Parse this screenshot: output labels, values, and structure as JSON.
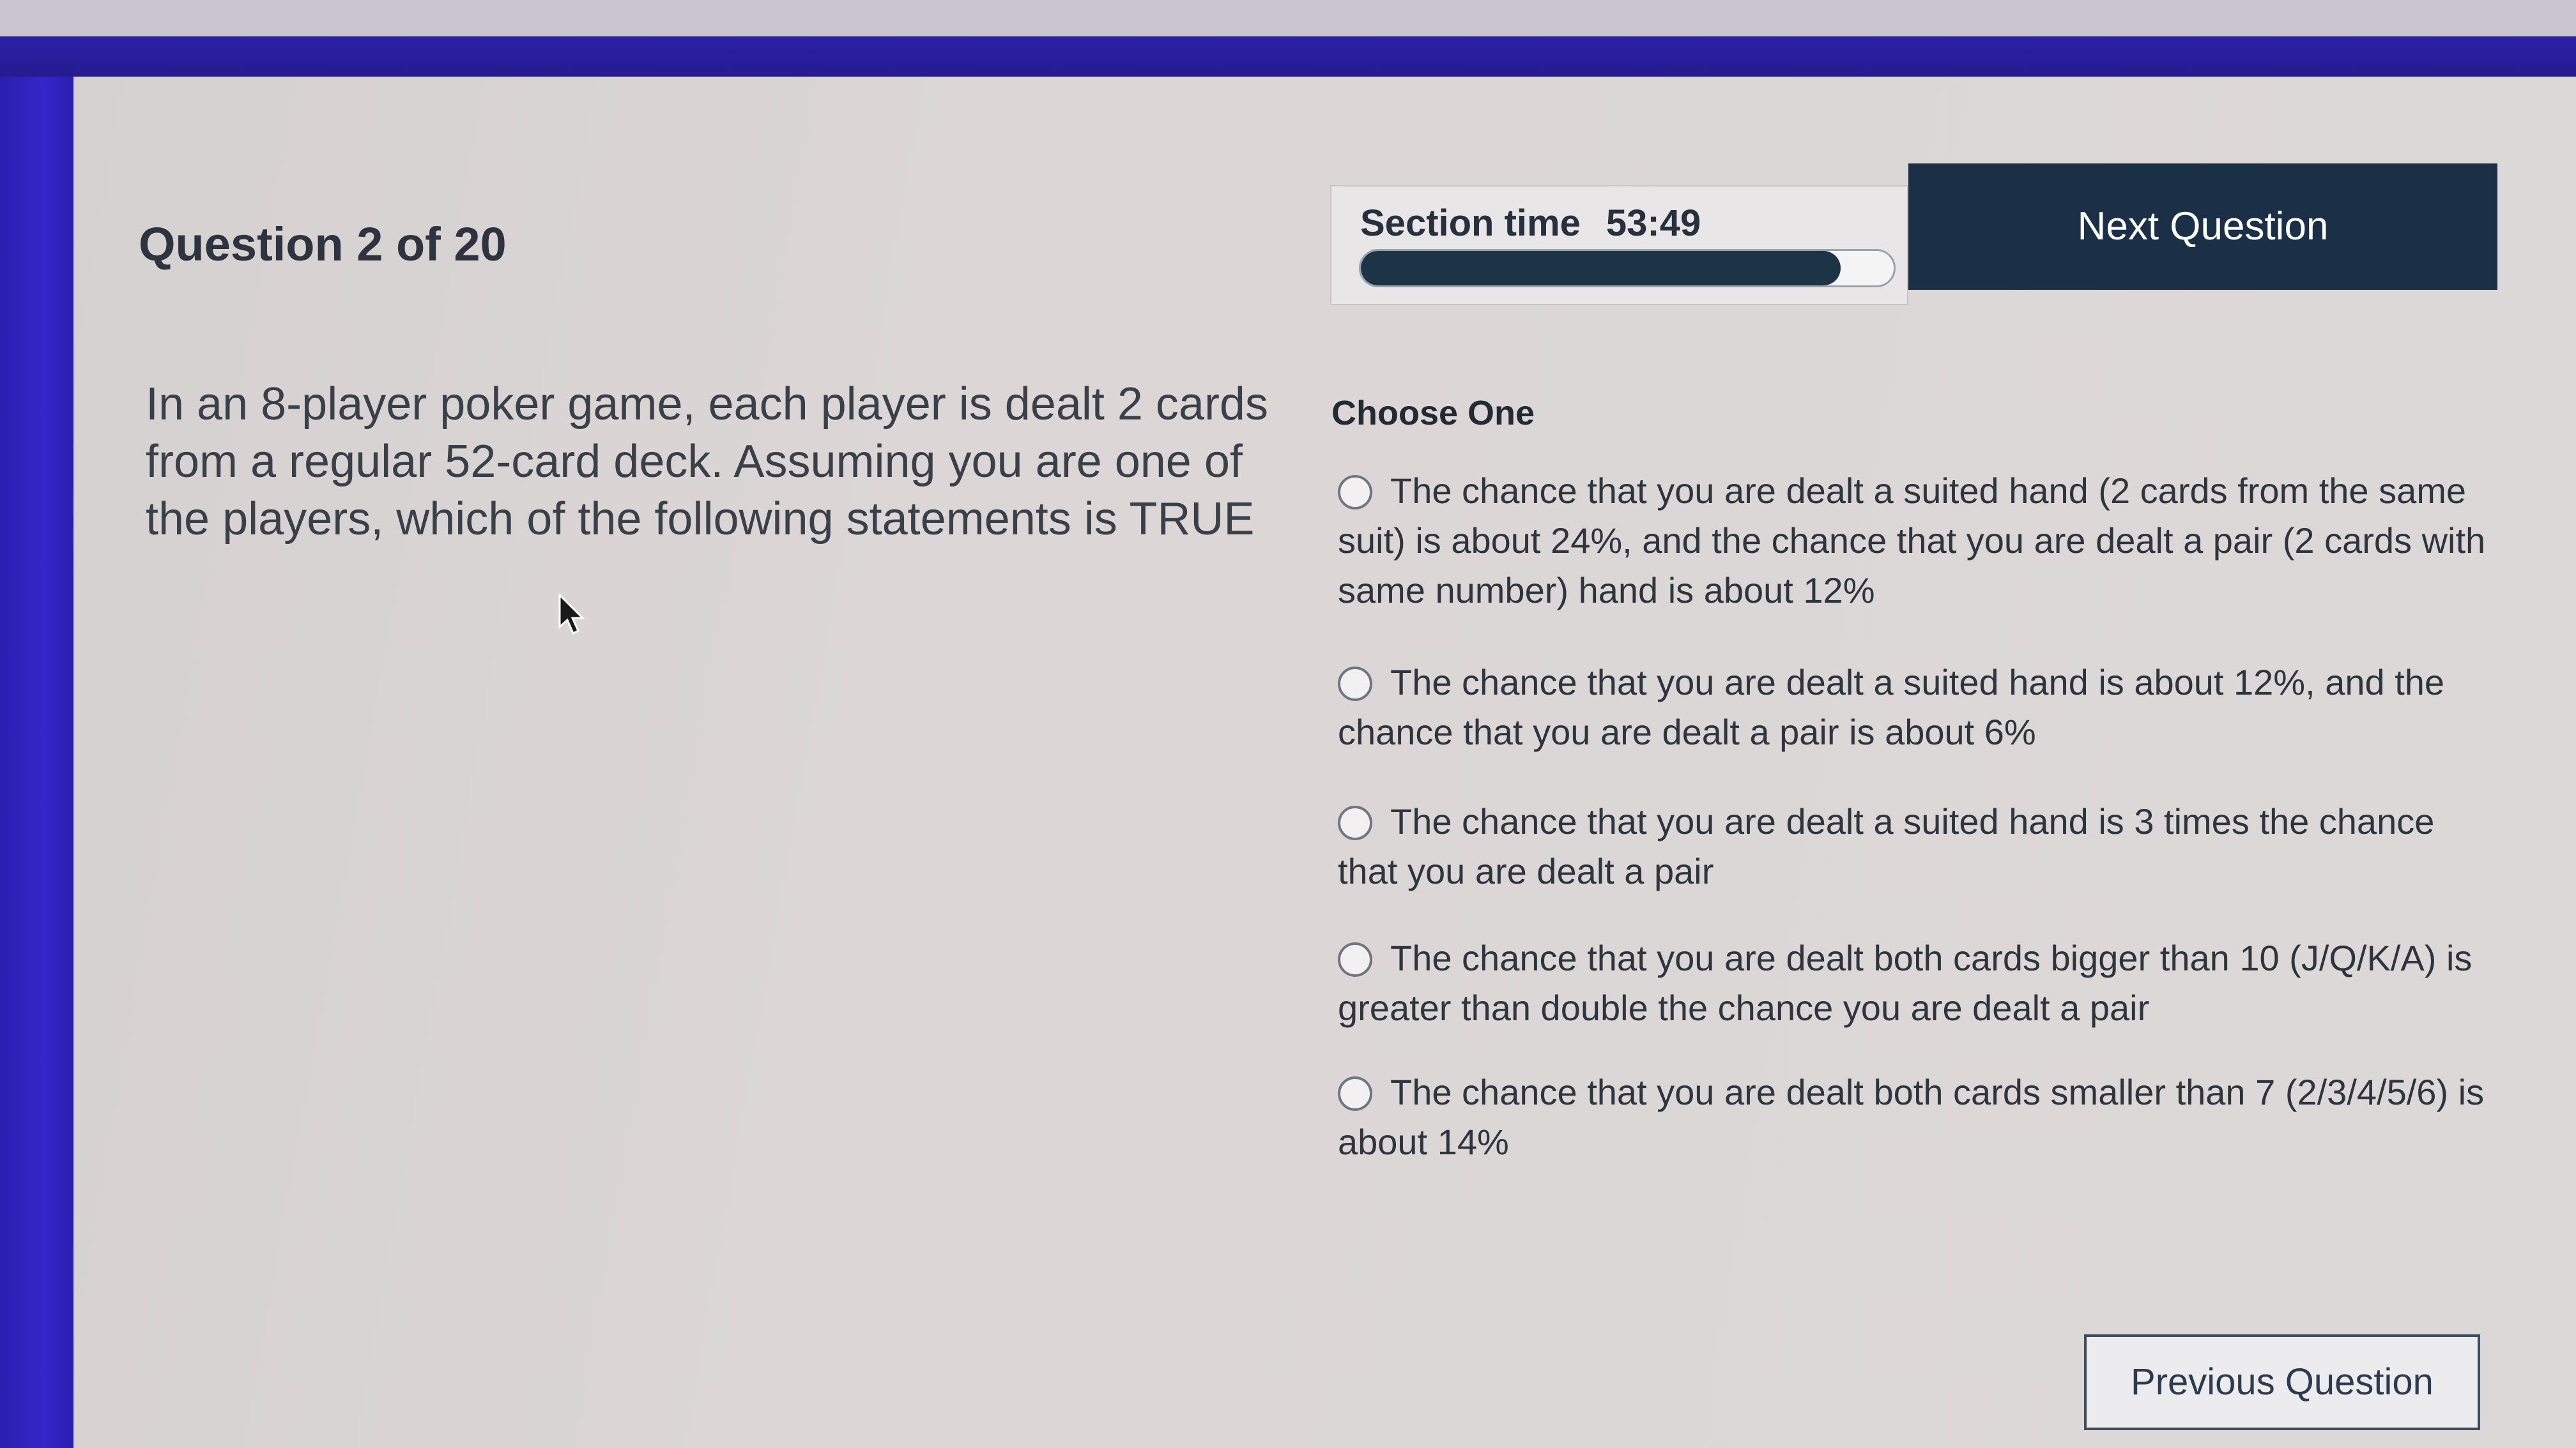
{
  "header": {
    "question_counter": "Question 2 of 20",
    "section_time_label": "Section time",
    "section_time_value": "53:49",
    "time_remaining_fraction": 0.9,
    "next_button_label": "Next Question"
  },
  "question": {
    "text": "In an 8-player poker game, each player is dealt 2 cards from a regular 52-card deck. Assuming you are one of the players, which of the following statements is TRUE"
  },
  "answers": {
    "instruction": "Choose One",
    "options": [
      {
        "label": "The chance that you are dealt a suited hand (2 cards from the same suit) is about 24%, and the chance that you are dealt a pair (2 cards with same number) hand is about 12%",
        "selected": false
      },
      {
        "label": "The chance that you are dealt a suited hand is about 12%, and the chance that you are dealt a pair is about 6%",
        "selected": false
      },
      {
        "label": "The chance that you are dealt a suited hand is 3 times the chance that you are dealt a pair",
        "selected": false
      },
      {
        "label": "The chance that you are dealt both cards bigger than 10 (J/Q/K/A) is greater than double the chance you are dealt a pair",
        "selected": false
      },
      {
        "label": "The chance that you are dealt both cards smaller than 7 (2/3/4/5/6) is about 14%",
        "selected": false
      }
    ]
  },
  "footer": {
    "previous_button_label": "Previous Question"
  },
  "icons": {
    "cursor": "mouse-pointer-icon",
    "radio": "radio-unselected-icon"
  },
  "colors": {
    "primary_button": "#1b2f46",
    "progress_fill": "#1d3346",
    "text": "#2f353d"
  }
}
